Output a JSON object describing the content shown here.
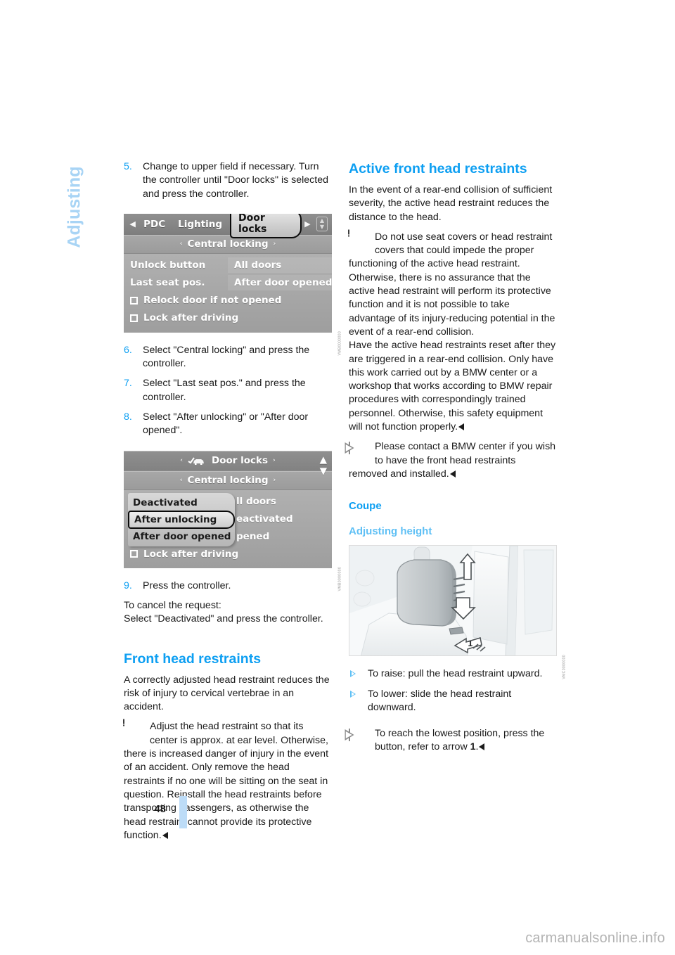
{
  "chapter_tab": {
    "label": "Adjusting"
  },
  "page_number": "48",
  "watermark": "carmanualsonline.info",
  "left_column": {
    "steps": [
      {
        "num": "5.",
        "text": "Change to upper field if necessary. Turn the controller until \"Door locks\" is selected and press the controller."
      },
      {
        "num": "6.",
        "text": "Select \"Central locking\" and press the controller."
      },
      {
        "num": "7.",
        "text": "Select \"Last seat pos.\" and press the controller."
      },
      {
        "num": "8.",
        "text": "Select \"After unlocking\" or \"After door opened\"."
      },
      {
        "num": "9.",
        "text": "Press the controller."
      }
    ],
    "cancel_line1": "To cancel the request:",
    "cancel_line2": "Select \"Deactivated\" and press the controller.",
    "heading_front_head_restraints": "Front head restraints",
    "intro_paragraph": "A correctly adjusted head restraint reduces the risk of injury to cervical vertebrae in an accident.",
    "warning": {
      "icon": "warning-triangle-icon",
      "text": "Adjust the head restraint so that its center is approx. at ear level. Otherwise, there is increased danger of injury in the event of an accident. Only remove the head restraints if no one will be sitting on the seat in question. Reinstall the head restraints before transporting passengers, as otherwise the head restraint cannot provide its protective function."
    }
  },
  "idrive_screen_1": {
    "caption_code": "VMB0000000",
    "topbar": {
      "left_arrow": "◀",
      "items": [
        "PDC",
        "Lighting"
      ],
      "selected": "Door locks",
      "right_arrow": "▶",
      "scroll_icon": "scroll-updown-icon"
    },
    "subbar": {
      "left_dot": "‹",
      "title": "Central locking",
      "right_dot": "›"
    },
    "rows": [
      {
        "label": "Unlock button",
        "value": "All doors"
      },
      {
        "label": "Last seat pos.",
        "value": "After door opened"
      }
    ],
    "checkboxes": [
      {
        "label": "Relock door if not opened",
        "checked": false
      },
      {
        "label": "Lock after driving",
        "checked": false
      }
    ]
  },
  "idrive_screen_2": {
    "caption_code": "VMB0000000",
    "topbar": {
      "left_dot": "‹",
      "car_icon": "checked-car-icon",
      "title": "Door locks",
      "right_dot": "›",
      "scroll_icon": "scroll-updown-icon"
    },
    "subbar": {
      "left_dot": "‹",
      "title": "Central locking",
      "right_dot": "›"
    },
    "popup_options": [
      {
        "label": "Deactivated",
        "selected": false
      },
      {
        "label": "After unlocking",
        "selected": true
      },
      {
        "label": "After door opened",
        "selected": false
      }
    ],
    "background_rows": [
      "ll doors",
      "eactivated",
      "pened"
    ],
    "checkbox": {
      "label": "Lock after driving",
      "checked": false
    }
  },
  "right_column": {
    "heading_active_front": "Active front head restraints",
    "active_intro": "In the event of a rear-end collision of sufficient severity, the active head restraint reduces the distance to the head.",
    "warning": {
      "icon": "warning-triangle-icon",
      "text": "Do not use seat covers or head restraint covers that could impede the proper functioning of the active head restraint. Otherwise, there is no assurance that the active head restraint will perform its protective function and it is not possible to take advantage of its injury-reducing potential in the event of a rear-end collision."
    },
    "reset_paragraph": "Have the active head restraints reset after they are triggered in a rear-end collision. Only have this work carried out by a BMW center or a workshop that works according to BMW repair procedures with correspondingly trained personnel. Otherwise, this safety equipment will not function properly.",
    "info": {
      "icon": "info-triangle-icon",
      "text": "Please contact a BMW center if you wish to have the front head restraints removed and installed."
    },
    "heading_coupe": "Coupe",
    "heading_adjusting_height": "Adjusting height",
    "photo": {
      "caption_code": "VMC0000000",
      "alt": "head-restraint-adjustment-illustration"
    },
    "bullets": [
      {
        "icon": "triangle-bullet-icon",
        "text": "To raise: pull the head restraint upward."
      },
      {
        "icon": "triangle-bullet-icon",
        "text": "To lower: slide the head restraint downward."
      }
    ],
    "lowest_position_info": {
      "icon": "info-triangle-icon",
      "text_before": "To reach the lowest position, press the button, refer to arrow ",
      "arrow_ref": "1",
      "text_after": "."
    }
  },
  "colors": {
    "accent_blue": "#0d9ff2",
    "light_blue": "#5fc0f5",
    "tab_blue": "#a8d4f5",
    "rule_blue": "#bddcf7",
    "text": "#1b1b1b"
  }
}
